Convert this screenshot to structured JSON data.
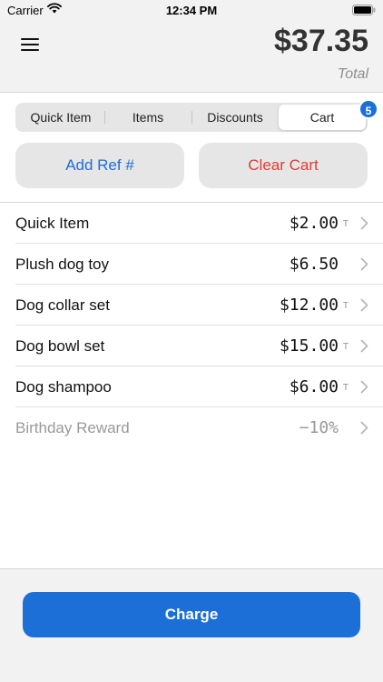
{
  "status_bar": {
    "carrier": "Carrier",
    "time": "12:34 PM"
  },
  "header": {
    "total_amount": "$37.35",
    "total_label": "Total"
  },
  "tabs": [
    {
      "label": "Quick Item",
      "active": false
    },
    {
      "label": "Items",
      "active": false
    },
    {
      "label": "Discounts",
      "active": false
    },
    {
      "label": "Cart",
      "active": true
    }
  ],
  "cart_badge": "5",
  "actions": {
    "add_ref_label": "Add Ref #",
    "clear_cart_label": "Clear Cart"
  },
  "cart_items": [
    {
      "name": "Quick Item",
      "price": "$2.00",
      "tax_flag": "T"
    },
    {
      "name": "Plush dog toy",
      "price": "$6.50",
      "tax_flag": ""
    },
    {
      "name": "Dog collar set",
      "price": "$12.00",
      "tax_flag": "T"
    },
    {
      "name": "Dog bowl set",
      "price": "$15.00",
      "tax_flag": "T"
    },
    {
      "name": "Dog shampoo",
      "price": "$6.00",
      "tax_flag": "T"
    },
    {
      "name": "Birthday Reward",
      "price": "−10%",
      "tax_flag": ""
    }
  ],
  "footer": {
    "charge_label": "Charge"
  },
  "colors": {
    "accent": "#1c6fd6",
    "danger": "#e53b2f",
    "muted": "#9a9a9a"
  },
  "icons": {
    "menu": "menu-icon",
    "wifi": "wifi-icon",
    "battery": "battery-icon",
    "chevron": "chevron-right-icon"
  }
}
